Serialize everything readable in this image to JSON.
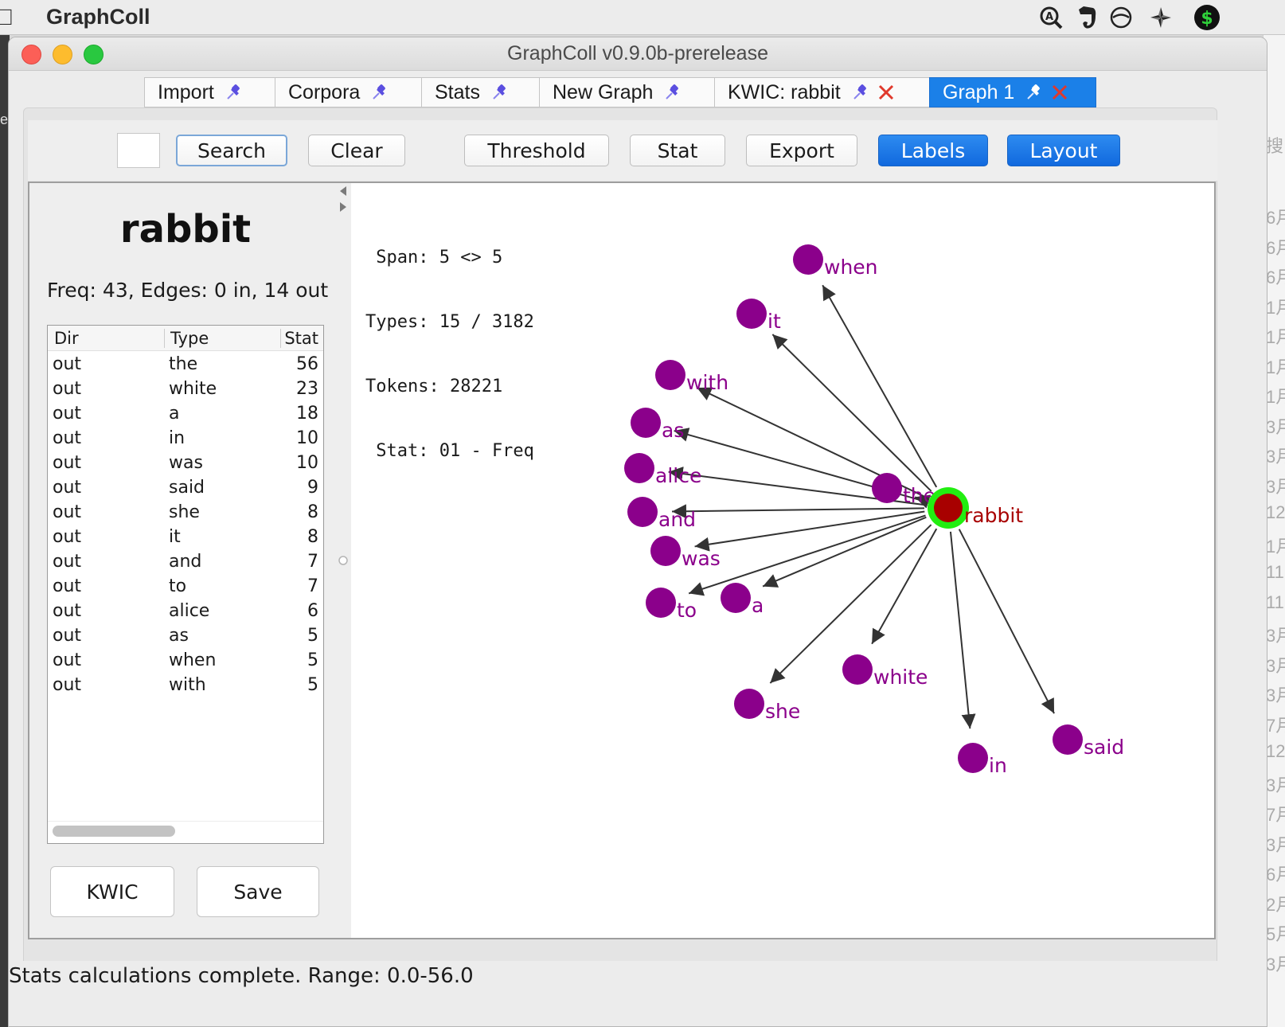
{
  "menubar": {
    "app_name": "GraphColl",
    "tray_icons": [
      "text-input-icon",
      "evernote-icon",
      "no-entry-icon",
      "pinwheel-icon",
      "dollar-app-icon"
    ]
  },
  "window": {
    "title": "GraphColl v0.9.0b-prerelease"
  },
  "tabs": [
    {
      "label": "Import",
      "closable": false,
      "active": false
    },
    {
      "label": "Corpora",
      "closable": false,
      "active": false
    },
    {
      "label": "Stats",
      "closable": false,
      "active": false
    },
    {
      "label": "New Graph",
      "closable": false,
      "active": false
    },
    {
      "label": "KWIC: rabbit",
      "closable": true,
      "active": false
    },
    {
      "label": "Graph 1",
      "closable": true,
      "active": true
    }
  ],
  "toolbar": {
    "search_value": "",
    "search_label": "Search",
    "clear_label": "Clear",
    "threshold_label": "Threshold",
    "stat_label": "Stat",
    "export_label": "Export",
    "labels_label": "Labels",
    "layout_label": "Layout"
  },
  "node_panel": {
    "title": "rabbit",
    "info": "Freq: 43, Edges: 0 in, 14 out",
    "columns": [
      "Dir",
      "Type",
      "Stat"
    ],
    "rows": [
      [
        "out",
        "the",
        "56"
      ],
      [
        "out",
        "white",
        "23"
      ],
      [
        "out",
        "a",
        "18"
      ],
      [
        "out",
        "in",
        "10"
      ],
      [
        "out",
        "was",
        "10"
      ],
      [
        "out",
        "said",
        "9"
      ],
      [
        "out",
        "she",
        "8"
      ],
      [
        "out",
        "it",
        "8"
      ],
      [
        "out",
        "and",
        "7"
      ],
      [
        "out",
        "to",
        "7"
      ],
      [
        "out",
        "alice",
        "6"
      ],
      [
        "out",
        "as",
        "5"
      ],
      [
        "out",
        "when",
        "5"
      ],
      [
        "out",
        "with",
        "5"
      ]
    ],
    "kwic_label": "KWIC",
    "save_label": "Save"
  },
  "graph": {
    "stats_lines": [
      " Span: 5 <> 5",
      "Types: 15 / 3182",
      "Tokens: 28221",
      " Stat: 01 - Freq"
    ],
    "center_label": "rabbit",
    "colors": {
      "node": "#8b008b",
      "center_ring": "#22ee11",
      "center_fill": "#a80000",
      "center_label": "#a80000",
      "edge": "#333333"
    },
    "nodes": [
      "when",
      "it",
      "with",
      "as",
      "alice",
      "the",
      "and",
      "was",
      "to",
      "a",
      "white",
      "she",
      "in",
      "said"
    ]
  },
  "status": {
    "text": "Stats calculations complete.  Range: 0.0-56.0"
  },
  "background_window": {
    "items": [
      "6月",
      "6月",
      "6月",
      "1月",
      "1月",
      "1月",
      "1月",
      "3月",
      "3月",
      "3月",
      "12",
      "1月",
      "11",
      "11",
      "3月",
      "3月",
      "3月",
      "7月",
      "12",
      "3月",
      "7月",
      "3月",
      "6月",
      "2月",
      "5月",
      "3月"
    ],
    "search_char": "搜"
  }
}
